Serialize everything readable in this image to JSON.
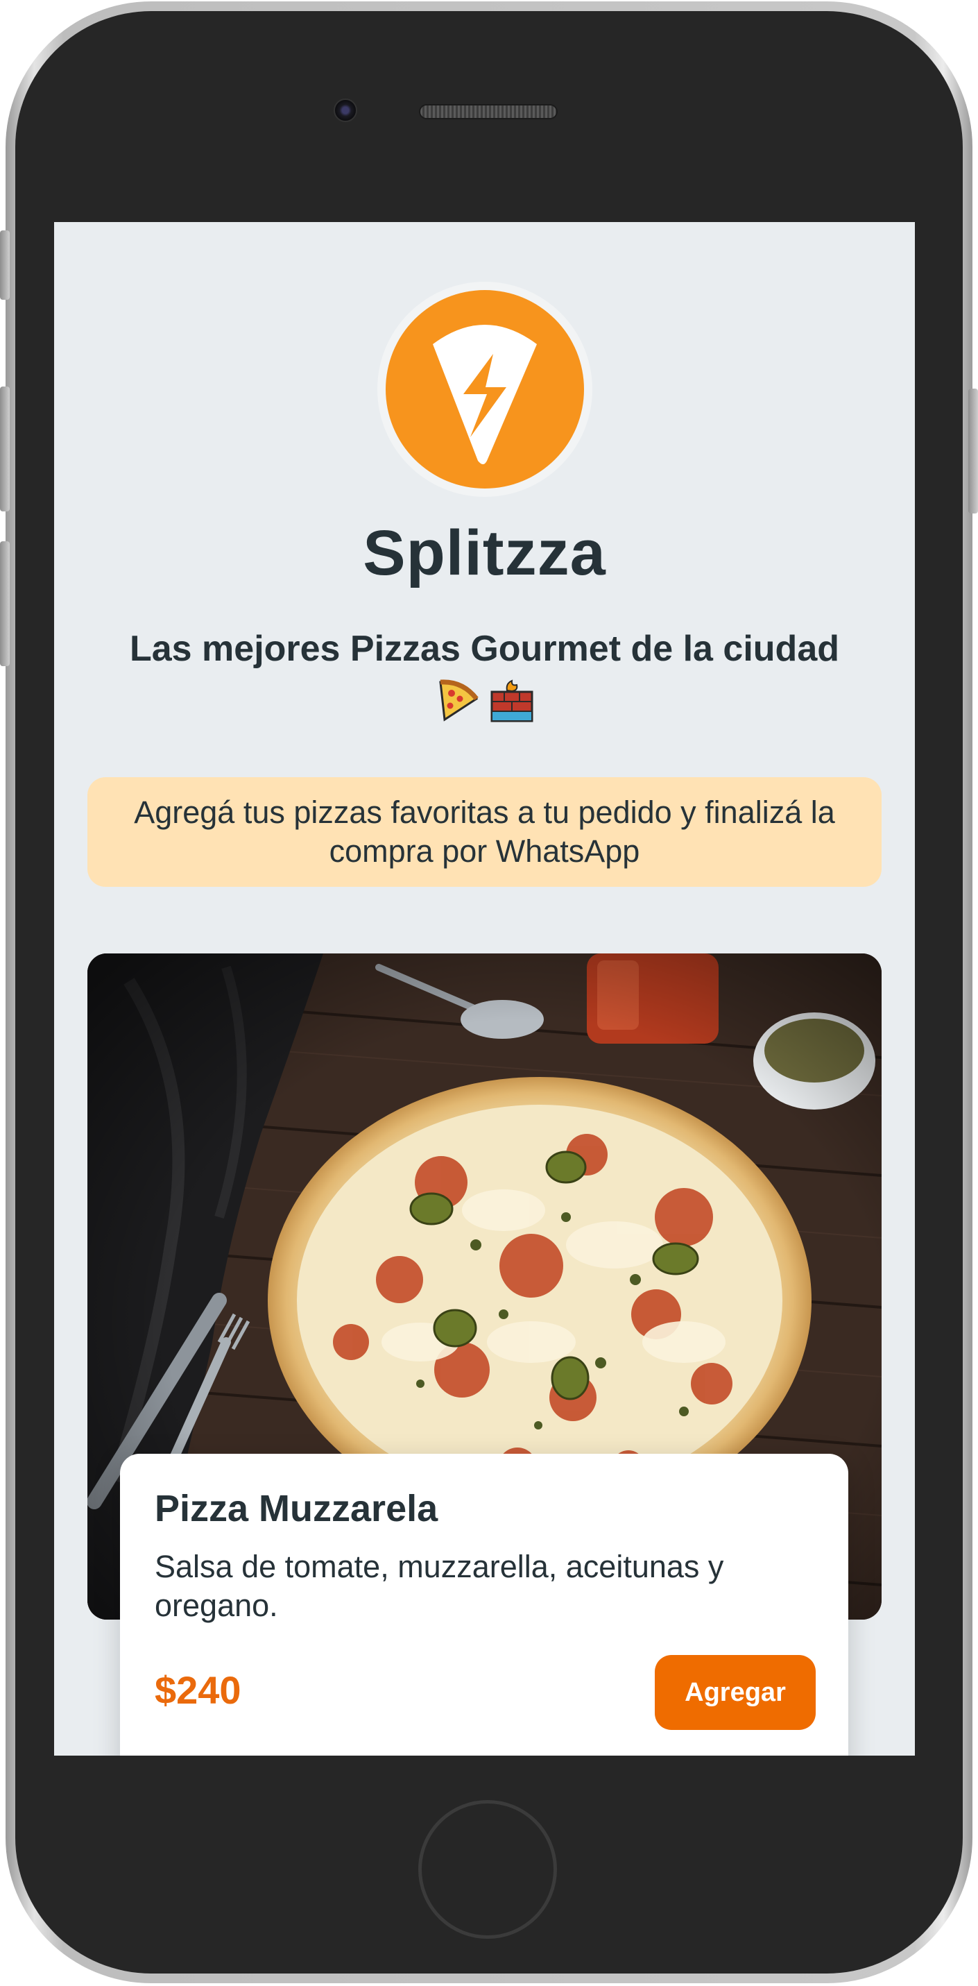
{
  "header": {
    "brand_name": "Splitzza",
    "tagline": "Las mejores Pizzas Gourmet de la ciudad",
    "tagline_icons": [
      "pizza-slice-icon",
      "brick-oven-icon"
    ]
  },
  "banner": {
    "text": "Agregá tus pizzas favoritas a tu pedido y finalizá la compra por WhatsApp"
  },
  "products": [
    {
      "name": "Pizza Muzzarela",
      "description": "Salsa de tomate, muzzarella, aceitunas y oregano.",
      "price": "$240",
      "button_label": "Agregar"
    }
  ],
  "colors": {
    "brand_orange": "#f7941d",
    "accent_orange": "#ef6c00",
    "price_orange": "#ea6a0c",
    "banner_bg": "#ffe2b4",
    "screen_bg": "#e9edf0",
    "text_dark": "#263238"
  }
}
